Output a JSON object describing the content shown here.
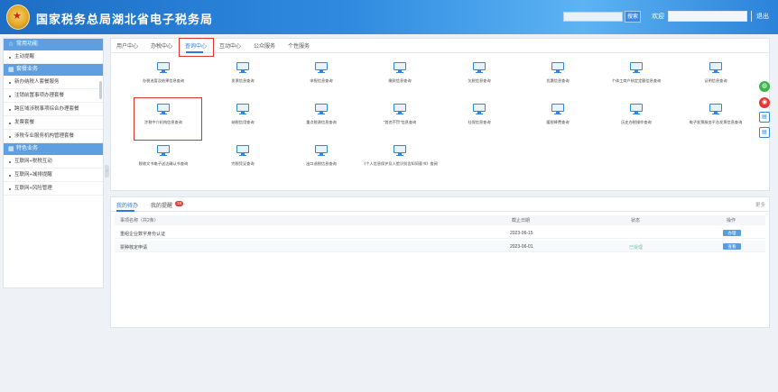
{
  "header": {
    "title": "国家税务总局湖北省电子税务局",
    "search_button": "搜索",
    "welcome": "欢迎",
    "logout": "退出"
  },
  "sidebar": {
    "sections": [
      {
        "title": "常用功能",
        "items": [
          "主动提醒"
        ]
      },
      {
        "title": "套餐业务",
        "items": [
          "新办纳税人套餐服务",
          "注销前置事项办理套餐",
          "跨区域涉税事项综合办理套餐",
          "发票套餐",
          "涉税专业服务机构管理套餐"
        ]
      },
      {
        "title": "特色业务",
        "items": [
          "互联网+税税互动",
          "互联网+减排提醒",
          "互联网+风险管理"
        ]
      }
    ],
    "collapse_icon": "‹"
  },
  "tabs": [
    "用户中心",
    "办税中心",
    "查询中心",
    "互动中心",
    "公众服务",
    "个性服务"
  ],
  "active_tab": "查询中心",
  "query_items": [
    "办税进度及结果信息查询",
    "发票信息查询",
    "申报信息查询",
    "缴款信息查询",
    "欠税信息查询",
    "优惠信息查询",
    "个体工商户核定定额信息查询",
    "证明信息查询",
    "涉税中介机构信息查询",
    "纳税信用查询",
    "重点税源信息查询",
    "\"首违不罚\"信息查询",
    "社保信息查询",
    "缓税降费查询",
    "历史办税操作查询",
    "电子发票服务平台发票信息查询",
    "税收文书电子送达确认书查询",
    "完税凭证查询",
    "出口退税信息查询",
    "《个人信息保护及人脸识别告知同意书》查阅"
  ],
  "todo": {
    "tabs": [
      "我的待办",
      "我的提醒"
    ],
    "badge": "18",
    "more": "更多",
    "columns": [
      "事项名称（共2条）",
      "截止日期",
      "状态",
      "操作"
    ],
    "rows": [
      {
        "name": "重组企业数字身份认证",
        "date": "2023-06-15",
        "status": "",
        "action": "办理"
      },
      {
        "name": "票种核定申请",
        "date": "2023-06-01",
        "status": "已受理",
        "action": "查看"
      }
    ]
  },
  "floating_icons": [
    "wechat-icon",
    "weibo-icon",
    "print-icon",
    "print-icon"
  ]
}
